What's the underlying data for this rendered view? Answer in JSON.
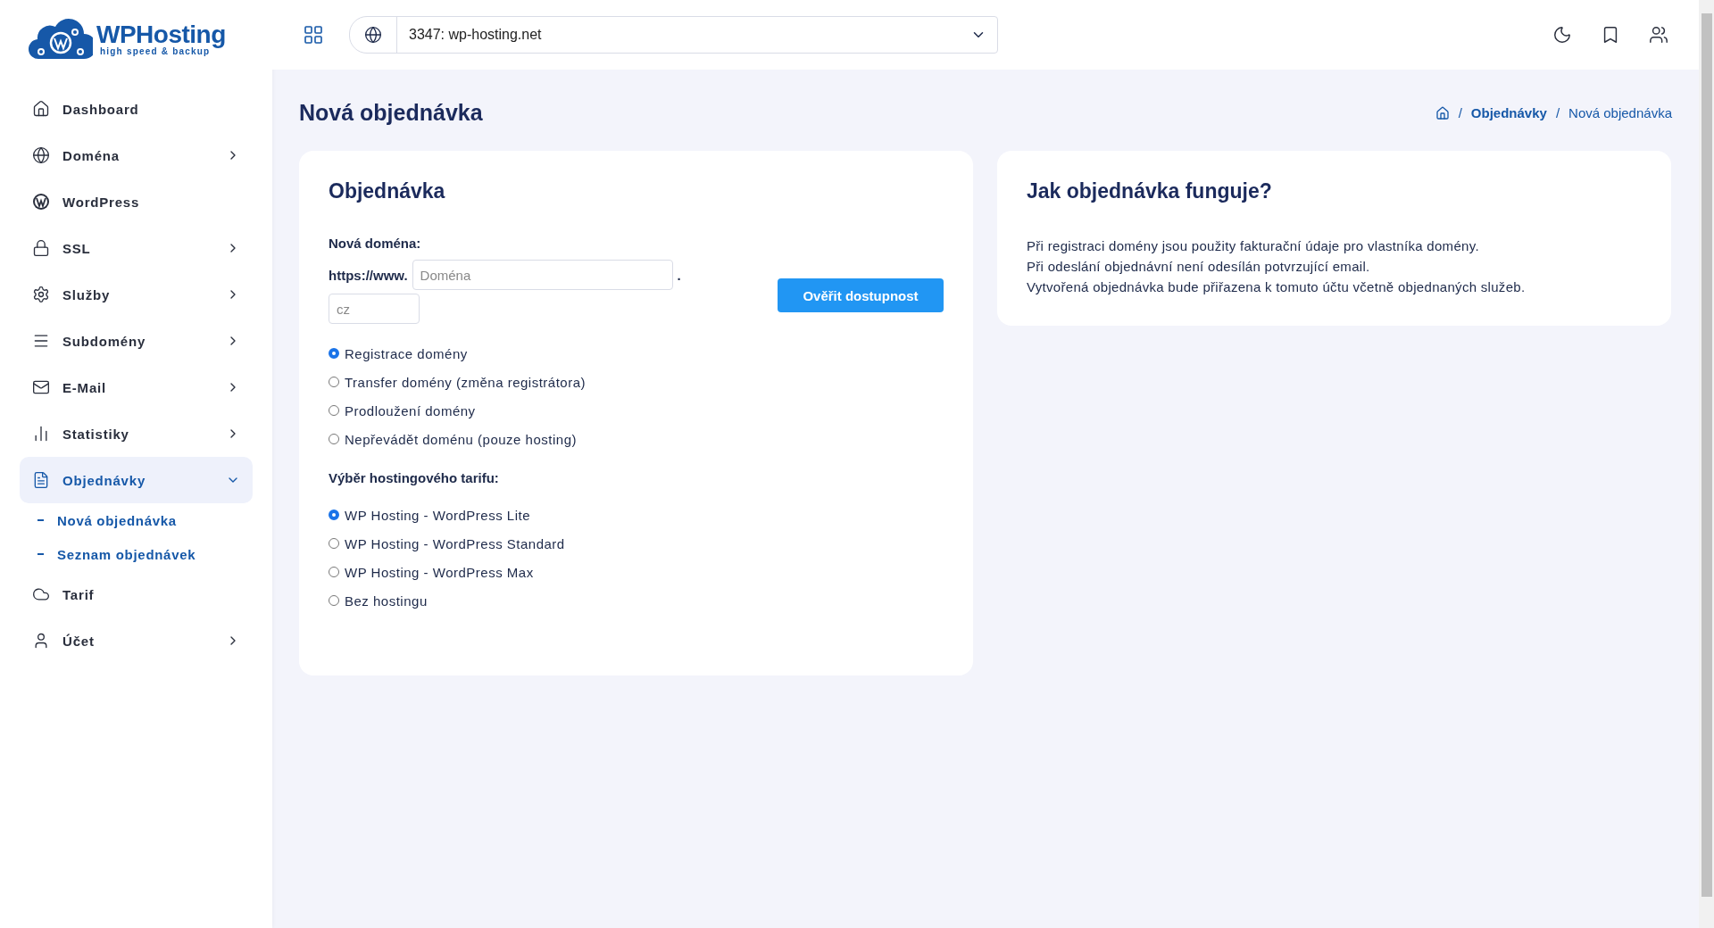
{
  "logo": {
    "name": "WPHosting",
    "tagline": "high speed & backup"
  },
  "sidebar": {
    "items": [
      {
        "label": "Dashboard",
        "selected": false
      },
      {
        "label": "Doména",
        "selected": false,
        "expanded": false
      },
      {
        "label": "WordPress",
        "selected": false
      },
      {
        "label": "SSL",
        "selected": false,
        "expanded": false
      },
      {
        "label": "Služby",
        "selected": false,
        "expanded": false
      },
      {
        "label": "Subdomény",
        "selected": false,
        "expanded": false
      },
      {
        "label": "E-Mail",
        "selected": false,
        "expanded": false
      },
      {
        "label": "Statistiky",
        "selected": false,
        "expanded": false
      },
      {
        "label": "Objednávky",
        "selected": true,
        "expanded": true,
        "children": [
          {
            "label": "Nová objednávka"
          },
          {
            "label": "Seznam objednávek"
          }
        ]
      },
      {
        "label": "Tarif",
        "selected": false
      },
      {
        "label": "Účet",
        "selected": false,
        "expanded": false
      }
    ]
  },
  "topbar": {
    "site_select": {
      "value": "3347: wp-hosting.net"
    }
  },
  "page": {
    "title": "Nová objednávka",
    "breadcrumb_separator": "/",
    "breadcrumb": [
      {
        "label": "Objednávky",
        "current": false
      },
      {
        "label": "Nová objednávka",
        "current": true
      }
    ]
  },
  "order_card": {
    "title": "Objednávka",
    "domain_label": "Nová doména:",
    "prefix": "https://www.",
    "domain_field": {
      "placeholder": "Doména"
    },
    "dot": ".",
    "tld_field": {
      "placeholder": "cz"
    },
    "check_button": "Ověřit dostupnost",
    "domain_options": [
      {
        "label": "Registrace domény",
        "selected": true
      },
      {
        "label": "Transfer domény (změna registrátora)",
        "selected": false
      },
      {
        "label": "Prodloužení domény",
        "selected": false
      },
      {
        "label": "Nepřevádět doménu (pouze hosting)",
        "selected": false
      }
    ],
    "plan_label": "Výběr hostingového tarifu:",
    "plan_options": [
      {
        "label": "WP Hosting - WordPress Lite",
        "selected": true
      },
      {
        "label": "WP Hosting - WordPress Standard",
        "selected": false
      },
      {
        "label": "WP Hosting - WordPress Max",
        "selected": false
      },
      {
        "label": "Bez hostingu",
        "selected": false
      }
    ]
  },
  "info_card": {
    "title": "Jak objednávka funguje?",
    "lines": [
      "Při registraci domény jsou použity fakturační údaje pro vlastníka domény.",
      "Při odeslání objednávní není odesílán potvrzující email.",
      "Vytvořená objednávka bude přiřazena k tomuto účtu včetně objednaných služeb."
    ]
  }
}
